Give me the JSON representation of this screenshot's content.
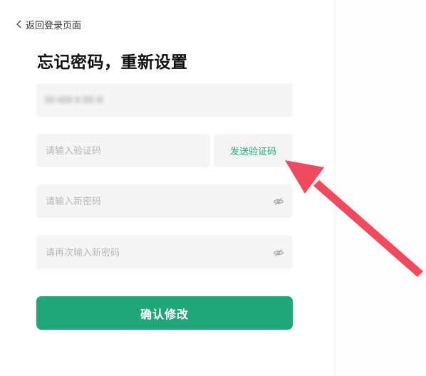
{
  "nav": {
    "back_label": "返回登录页面"
  },
  "page_title": "忘记密码，重新设置",
  "account_field": {
    "value_masked": true
  },
  "code_field": {
    "placeholder": "请输入验证码"
  },
  "send_code_button": {
    "label": "发送验证码"
  },
  "new_password_field": {
    "placeholder": "请输入新密码"
  },
  "confirm_password_field": {
    "placeholder": "请再次输入新密码"
  },
  "submit_button": {
    "label": "确认修改"
  },
  "colors": {
    "accent": "#21a67a",
    "annotation_arrow": "#f04a5f",
    "field_bg": "#f5f5f5"
  },
  "icons": {
    "back": "chevron-left-icon",
    "password_visibility": "eye-off-icon"
  }
}
